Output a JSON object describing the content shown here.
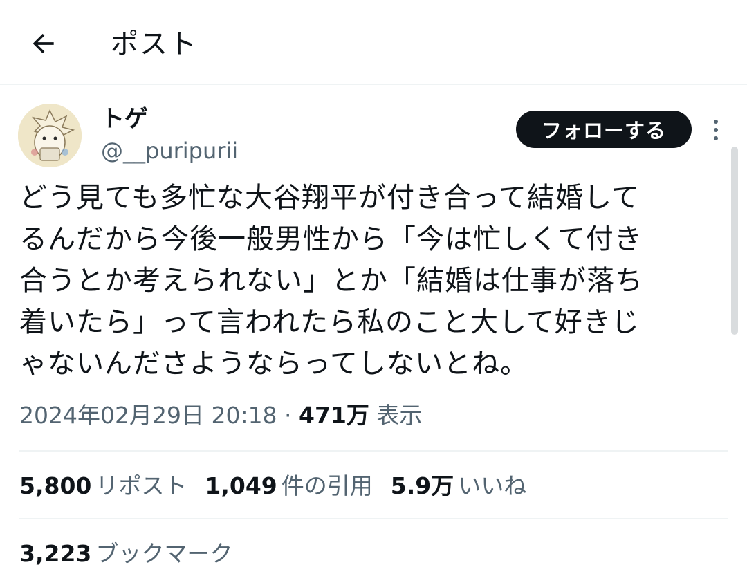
{
  "header": {
    "title": "ポスト"
  },
  "tweet": {
    "author": {
      "display_name": "トゲ",
      "handle": "@__puripurii"
    },
    "follow_label": "フォローする",
    "text_lines": [
      "どう見ても多忙な大谷翔平が付き合って結婚して",
      "るんだから今後一般男性から「今は忙しくて付き",
      "合うとか考えられない」とか「結婚は仕事が落ち",
      "着いたら」って言われたら私のこと大して好きじ",
      "ゃないんださようならってしないとね。"
    ],
    "timestamp": "2024年02月29日 20:18",
    "separator": " · ",
    "views_count": "471万",
    "views_label": "表示"
  },
  "stats": {
    "reposts": {
      "num": "5,800",
      "label": "リポスト"
    },
    "quotes": {
      "num": "1,049",
      "label": "件の引用"
    },
    "likes": {
      "num": "5.9万",
      "label": "いいね"
    },
    "bookmarks": {
      "num": "3,223",
      "label": "ブックマーク"
    }
  },
  "icons": {
    "back": "arrow-left-icon",
    "more": "more-vertical-icon"
  },
  "colors": {
    "text_primary": "#0f1419",
    "text_secondary": "#536471",
    "divider": "#eff3f4",
    "follow_bg": "#0f1419"
  }
}
